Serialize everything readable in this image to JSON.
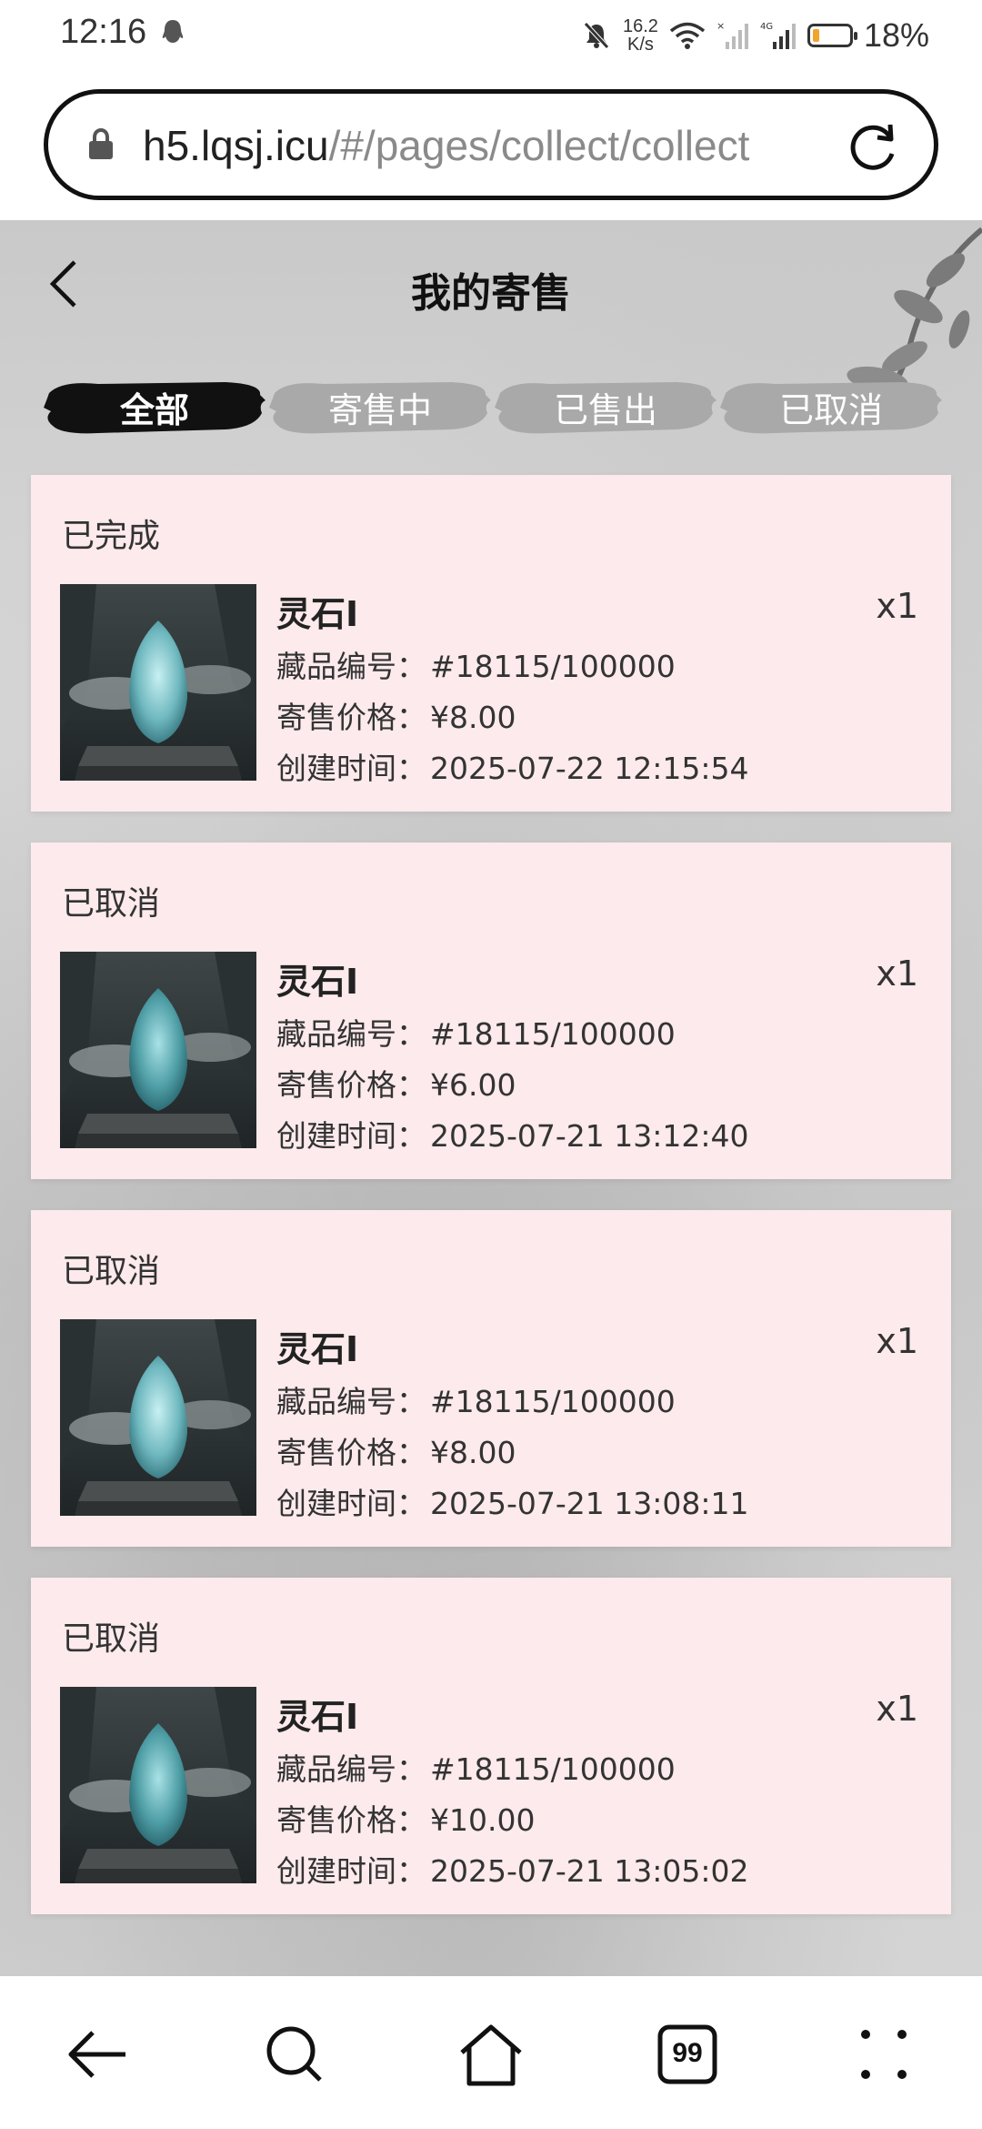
{
  "status_bar": {
    "time": "12:16",
    "net_speed_value": "16.2",
    "net_speed_unit": "K/s",
    "battery_percent": "18%",
    "battery_level": 0.18
  },
  "address_bar": {
    "url_host": "h5.lqsj.icu",
    "url_path": "/#/pages/collect/collect"
  },
  "page": {
    "title": "我的寄售"
  },
  "tabs": [
    {
      "label": "全部",
      "active": true
    },
    {
      "label": "寄售中",
      "active": false
    },
    {
      "label": "已售出",
      "active": false
    },
    {
      "label": "已取消",
      "active": false
    }
  ],
  "labels": {
    "serial": "藏品编号：",
    "price": "寄售价格：",
    "created": "创建时间："
  },
  "orders": [
    {
      "status": "已完成",
      "name": "灵石I",
      "qty": "x1",
      "serial": "#18115/100000",
      "price": "¥8.00",
      "created": "2025-07-22 12:15:54"
    },
    {
      "status": "已取消",
      "name": "灵石I",
      "qty": "x1",
      "serial": "#18115/100000",
      "price": "¥6.00",
      "created": "2025-07-21 13:12:40"
    },
    {
      "status": "已取消",
      "name": "灵石I",
      "qty": "x1",
      "serial": "#18115/100000",
      "price": "¥8.00",
      "created": "2025-07-21 13:08:11"
    },
    {
      "status": "已取消",
      "name": "灵石I",
      "qty": "x1",
      "serial": "#18115/100000",
      "price": "¥10.00",
      "created": "2025-07-21 13:05:02"
    }
  ],
  "bottom_nav": {
    "tabs_count": "99"
  },
  "colors": {
    "card_bg": "#fceaec",
    "tab_active": "#111111",
    "tab_inactive": "#a9a9a9",
    "battery_fill": "#f2a32a"
  }
}
